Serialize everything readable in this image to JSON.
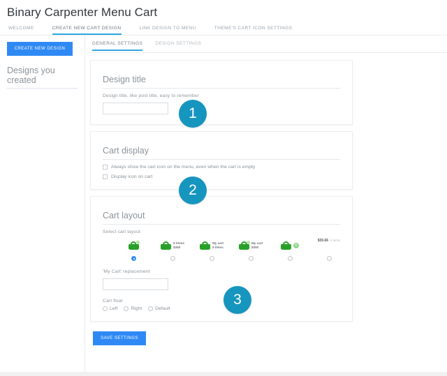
{
  "header": {
    "title": "Binary Carpenter Menu Cart"
  },
  "top_nav": {
    "items": [
      {
        "label": "WELCOME",
        "active": false
      },
      {
        "label": "CREATE NEW CART DESIGN",
        "active": true
      },
      {
        "label": "LINK DESIGN TO MENU",
        "active": false
      },
      {
        "label": "THEME'S CART ICON SETTINGS",
        "active": false
      }
    ]
  },
  "sidebar": {
    "create_button": "CREATE NEW DESIGN",
    "designs_heading": "Designs you created"
  },
  "sub_tabs": {
    "items": [
      {
        "label": "GENERAL SETTINGS",
        "active": true
      },
      {
        "label": "DESIGN SETTINGS",
        "active": false
      }
    ]
  },
  "design_title_card": {
    "title": "Design title",
    "field_label": "Design title, like post title, easy to remember",
    "input_value": "",
    "input_placeholder": ""
  },
  "cart_display_card": {
    "title": "Cart display",
    "checkboxes": [
      {
        "label": "Always show the cart icon on the menu, even when the cart is empty",
        "checked": false
      },
      {
        "label": "Display icon on cart",
        "checked": false
      }
    ]
  },
  "cart_layout_card": {
    "title": "Cart layout",
    "select_label": "Select cart layout",
    "options": [
      {
        "type": "icon-only",
        "line1": "",
        "line2": "",
        "checked": true
      },
      {
        "type": "icon-text",
        "line1": "5 items",
        "line2": "$350",
        "checked": false
      },
      {
        "type": "icon-text",
        "line1": "My cart",
        "line2": "5 items",
        "checked": false
      },
      {
        "type": "icon-badge-text",
        "line1": "My cart",
        "line2": "$350",
        "checked": false
      },
      {
        "type": "icon-badge",
        "badge": "5",
        "line1": "",
        "line2": "",
        "checked": false
      },
      {
        "type": "price-only",
        "price": "$35.66",
        "items": "5 items",
        "checked": false
      }
    ],
    "replacement_label": "'My Cart' replacement",
    "replacement_value": "",
    "float_label": "Cart float",
    "float_options": [
      {
        "label": "Left",
        "checked": false
      },
      {
        "label": "Right",
        "checked": false
      },
      {
        "label": "Default",
        "checked": false
      }
    ]
  },
  "badges": {
    "one": "1",
    "two": "2",
    "three": "3"
  },
  "footer": {
    "save_label": "SAVE SETTINGS"
  },
  "colors": {
    "accent_blue": "#2f89f5",
    "badge_teal": "#1695be",
    "tab_underline": "#2fa8e0",
    "cart_green": "#27a127"
  }
}
